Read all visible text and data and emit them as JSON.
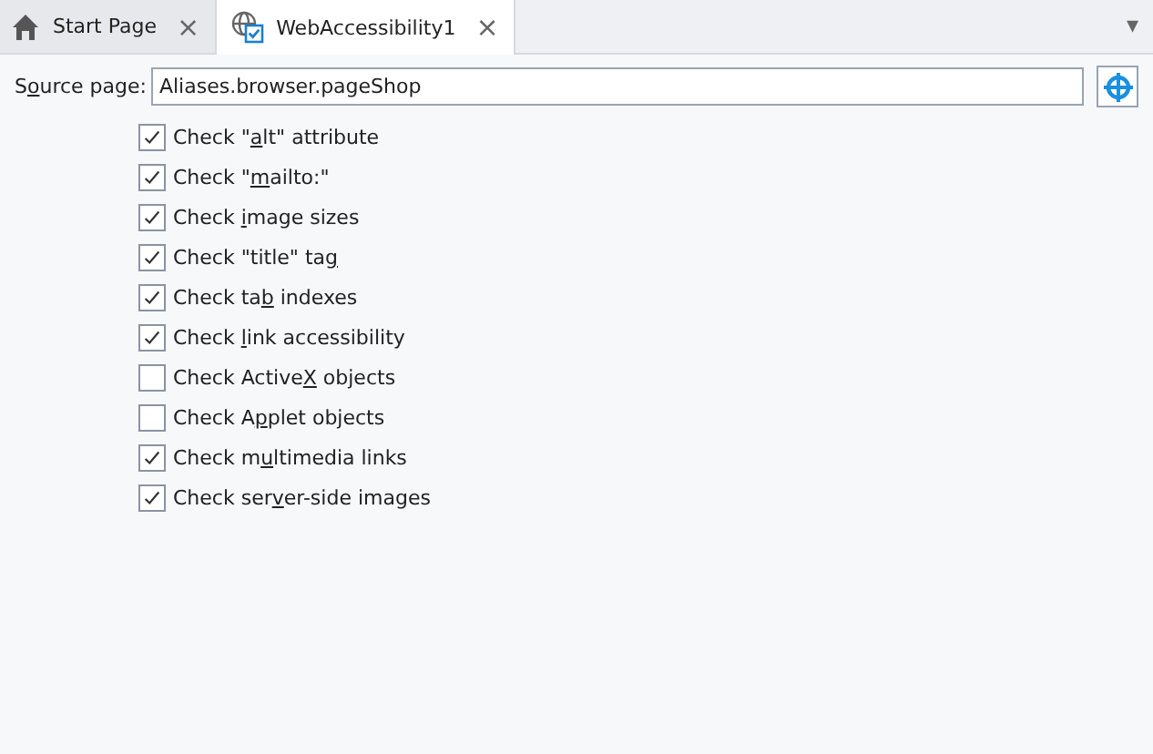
{
  "tabs": [
    {
      "kind": "home",
      "label": "Start Page",
      "close": "×",
      "selected": false
    },
    {
      "kind": "web",
      "label": "WebAccessibility1",
      "close": "×",
      "selected": true
    }
  ],
  "tab_menu": "▾",
  "source": {
    "label": {
      "pre": "S",
      "key": "o",
      "post": "urce page:"
    },
    "value": "Aliases.browser.pageShop"
  },
  "checks": [
    {
      "pre": "Check \"",
      "key": "a",
      "post": "lt\" attribute",
      "checked": true
    },
    {
      "pre": "Check \"",
      "key": "m",
      "post": "ailto:\"",
      "checked": true
    },
    {
      "pre": "Check ",
      "key": "i",
      "post": "mage sizes",
      "checked": true
    },
    {
      "pre": "Check \"title\" ta",
      "key": "g",
      "checked": true
    },
    {
      "pre": "Check ta",
      "key": "b",
      "post": " indexes",
      "checked": true
    },
    {
      "pre": "Check ",
      "key": "l",
      "post": "ink accessibility",
      "checked": true
    },
    {
      "pre": "Check Active",
      "key": "X",
      "post": " objects",
      "checked": false
    },
    {
      "pre": "Check A",
      "key": "p",
      "post": "plet objects",
      "checked": false
    },
    {
      "pre": "Check m",
      "key": "u",
      "post": "ltimedia links",
      "checked": true
    },
    {
      "pre": "Check ser",
      "key": "v",
      "post": "er-side images",
      "checked": true
    }
  ]
}
